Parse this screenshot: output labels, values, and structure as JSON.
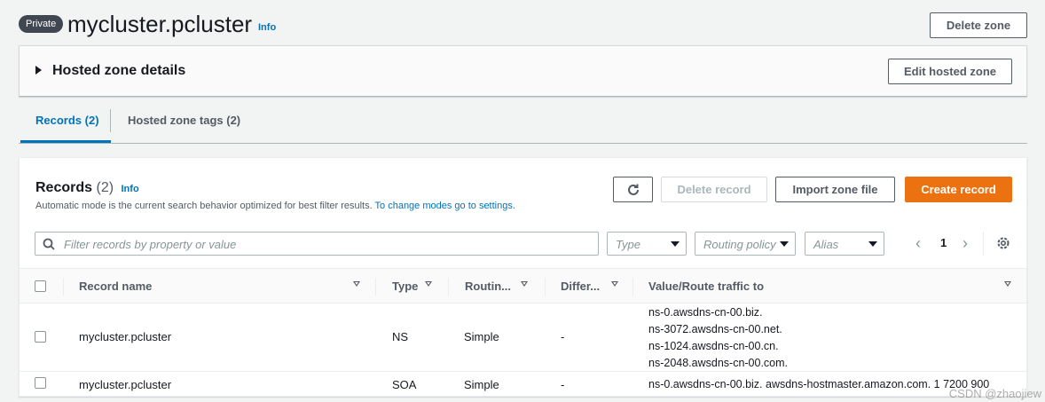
{
  "header": {
    "badge": "Private",
    "title": "mycluster.pcluster",
    "info": "Info",
    "delete_zone": "Delete zone"
  },
  "details": {
    "title": "Hosted zone details",
    "edit_button": "Edit hosted zone"
  },
  "tabs": [
    {
      "label": "Records (2)",
      "active": true
    },
    {
      "label": "Hosted zone tags (2)",
      "active": false
    }
  ],
  "records": {
    "title": "Records",
    "count": "(2)",
    "info": "Info",
    "description": "Automatic mode is the current search behavior optimized for best filter results.",
    "description_link": "To change modes go to settings.",
    "refresh_icon": "refresh-icon",
    "delete_button": "Delete record",
    "import_button": "Import zone file",
    "create_button": "Create record",
    "filter_placeholder": "Filter records by property or value",
    "filters": {
      "type": "Type",
      "routing_policy": "Routing policy",
      "alias": "Alias"
    },
    "pager": {
      "prev": "‹",
      "page": "1",
      "next": "›"
    },
    "columns": {
      "record_name": "Record name",
      "type": "Type",
      "routing": "Routin...",
      "differ": "Differ...",
      "value": "Value/Route traffic to"
    },
    "rows": [
      {
        "name": "mycluster.pcluster",
        "type": "NS",
        "routing": "Simple",
        "differ": "-",
        "values": [
          "ns-0.awsdns-cn-00.biz.",
          "ns-3072.awsdns-cn-00.net.",
          "ns-1024.awsdns-cn-00.cn.",
          "ns-2048.awsdns-cn-00.com."
        ]
      },
      {
        "name": "mycluster.pcluster",
        "type": "SOA",
        "routing": "Simple",
        "differ": "-",
        "values": [
          "ns-0.awsdns-cn-00.biz. awsdns-hostmaster.amazon.com. 1 7200 900"
        ]
      }
    ]
  },
  "watermark": "CSDN @zhaojiew",
  "colors": {
    "accent": "#0073bb",
    "primary": "#ec7211"
  }
}
